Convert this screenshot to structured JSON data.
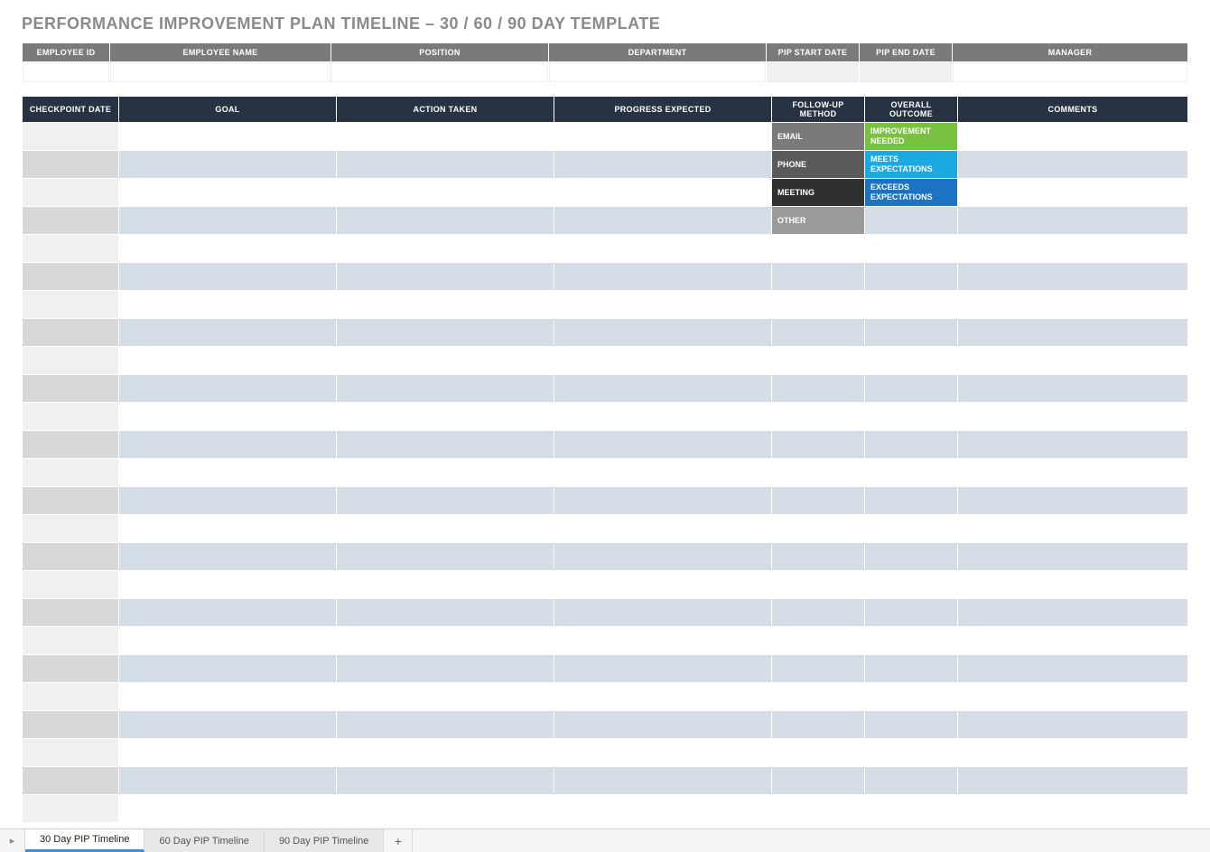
{
  "title": "PERFORMANCE IMPROVEMENT PLAN TIMELINE  –  30 / 60 / 90 DAY TEMPLATE",
  "info_headers": {
    "employee_id": "EMPLOYEE ID",
    "employee_name": "EMPLOYEE NAME",
    "position": "POSITION",
    "department": "DEPARTMENT",
    "pip_start": "PIP START DATE",
    "pip_end": "PIP END DATE",
    "manager": "MANAGER"
  },
  "info_values": {
    "employee_id": "",
    "employee_name": "",
    "position": "",
    "department": "",
    "pip_start": "",
    "pip_end": "",
    "manager": ""
  },
  "timeline_headers": {
    "checkpoint": "CHECKPOINT DATE",
    "goal": "GOAL",
    "action": "ACTION TAKEN",
    "progress": "PROGRESS EXPECTED",
    "followup": "FOLLOW-UP METHOD",
    "outcome": "OVERALL OUTCOME",
    "comments": "COMMENTS"
  },
  "followup_options": {
    "email": "EMAIL",
    "phone": "PHONE",
    "meeting": "MEETING",
    "other": "OTHER"
  },
  "outcome_options": {
    "improvement": "IMPROVEMENT NEEDED",
    "meets": "MEETS EXPECTATIONS",
    "exceeds": "EXCEEDS EXPECTATIONS"
  },
  "tabs": {
    "t30": "30 Day PIP Timeline",
    "t60": "60 Day PIP Timeline",
    "t90": "90 Day PIP Timeline"
  }
}
